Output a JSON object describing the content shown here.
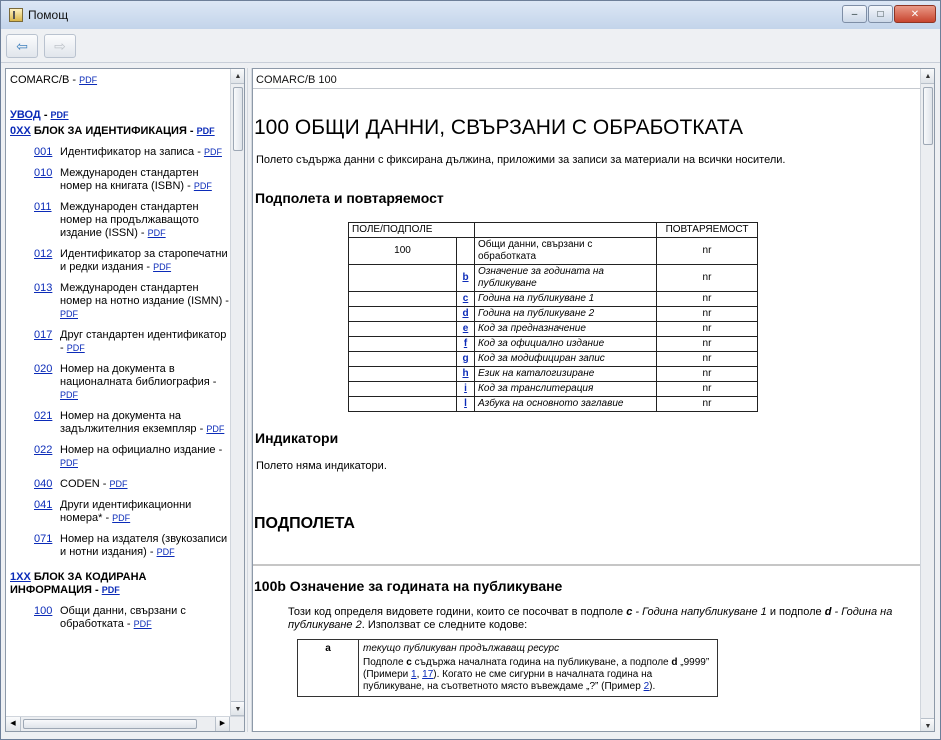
{
  "window": {
    "title": "Помощ",
    "controls": {
      "minimize": "–",
      "maximize": "□",
      "close": "✕"
    }
  },
  "toolbar": {
    "back": "⇦",
    "forward": "⇨"
  },
  "left": {
    "header": "COMARC/B - ",
    "pdf": "PDF",
    "sections": [
      {
        "code": "УВОД",
        "title": " - "
      },
      {
        "code": "0XX",
        "title": " БЛОК ЗА ИДЕНТИФИКАЦИЯ - "
      }
    ],
    "items": [
      {
        "code": "001",
        "title": "Идентификатор на записа - "
      },
      {
        "code": "010",
        "title": "Международен стандартен номер на книгата (ISBN) - "
      },
      {
        "code": "011",
        "title": "Международен стандартен номер на продължаващото издание (ISSN) - "
      },
      {
        "code": "012",
        "title": "Идентификатор за старопечатни и редки издания - "
      },
      {
        "code": "013",
        "title": "Международен стандартен номер на нотно издание (ISMN) - "
      },
      {
        "code": "017",
        "title": "Друг стандартен идентификатор - "
      },
      {
        "code": "020",
        "title": "Номер на документа в националната библиография - "
      },
      {
        "code": "021",
        "title": "Номер на документа на задължителния екземпляр - "
      },
      {
        "code": "022",
        "title": "Номер на официално издание - "
      },
      {
        "code": "040",
        "title": "CODEN - "
      },
      {
        "code": "041",
        "title": "Други идентификационни номера* - "
      },
      {
        "code": "071",
        "title": "Номер на издателя (звукозаписи и нотни издания) - "
      }
    ],
    "section2": {
      "code": "1XX",
      "title": " БЛОК ЗА КОДИРАНА ИНФОРМАЦИЯ - "
    },
    "item100": {
      "code": "100",
      "title": "Общи данни, свързани с обработката - "
    }
  },
  "right": {
    "breadcrumb": "COMARC/B 100",
    "heading": "100 ОБЩИ ДАННИ, СВЪРЗАНИ С ОБРАБОТКАТА",
    "intro": "Полето съдържа данни с фиксирана дължина, приложими за записи за материали на всички носители.",
    "subfields_heading": "Подполета и повтаряемост",
    "table": {
      "col1": "ПОЛЕ/ПОДПОЛЕ",
      "col3": "ПОВТАРЯЕМОСТ",
      "field": "100",
      "field_desc": "Общи данни, свързани с обработката",
      "field_rep": "nr",
      "rows": [
        {
          "code": "b",
          "desc": "Означение за годината на публикуване",
          "rep": "nr"
        },
        {
          "code": "c",
          "desc": "Година на публикуване 1",
          "rep": "nr"
        },
        {
          "code": "d",
          "desc": "Година на публикуване 2",
          "rep": "nr"
        },
        {
          "code": "e",
          "desc": "Код за предназначение",
          "rep": "nr"
        },
        {
          "code": "f",
          "desc": "Код за официално издание",
          "rep": "nr"
        },
        {
          "code": "g",
          "desc": "Код за модифициран запис",
          "rep": "nr"
        },
        {
          "code": "h",
          "desc": "Език на каталогизиране",
          "rep": "nr"
        },
        {
          "code": "i",
          "desc": "Код за транслитерация",
          "rep": "nr"
        },
        {
          "code": "l",
          "desc": "Азбука на основното заглавие",
          "rep": "nr"
        }
      ]
    },
    "indicators_heading": "Индикатори",
    "indicators_text": "Полето няма индикатори.",
    "subfields_title": "ПОДПОЛЕТА",
    "sub100b_heading": "100b Означение за годината на публикуване",
    "sub100b_intro_1": "Този код определя видовете години, които се посочват в подполе ",
    "sub100b_c": "c",
    "sub100b_intro_2": " - Година напубликуване 1",
    "sub100b_intro_3": " и подполе ",
    "sub100b_d": "d",
    "sub100b_intro_4": " - Година на публикуване 2",
    "sub100b_intro_5": ". Използват се следните кодове:",
    "code_a": "a",
    "code_a_title": "текущо публикуван продължаващ ресурс",
    "code_a_text_1": "Подполе ",
    "code_a_c": "c",
    "code_a_text_2": " съдържа началната година на публикуване, а подполе ",
    "code_a_d": "d",
    "code_a_text_3": " „9999” (Примери ",
    "ex1": "1",
    "comma": ", ",
    "ex17": "17",
    "code_a_text_4": "). Когато не сме сигурни в началната година на публикуване, на съответното място въвеждаме „?” (Пример ",
    "ex2": "2",
    "code_a_text_5": ")."
  }
}
